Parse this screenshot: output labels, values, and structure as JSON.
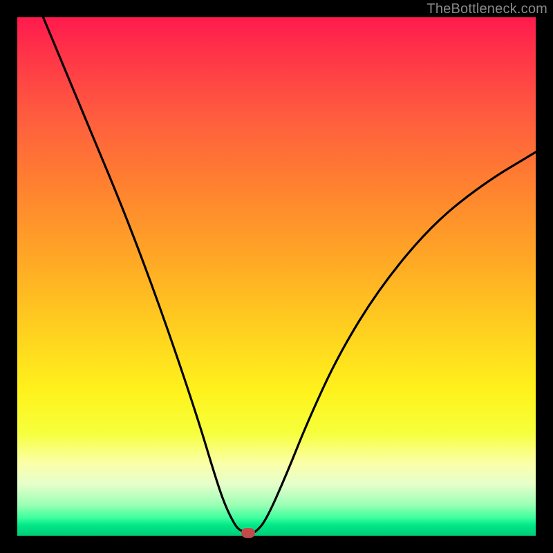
{
  "watermark": "TheBottleneck.com",
  "chart_data": {
    "type": "line",
    "title": "",
    "xlabel": "",
    "ylabel": "",
    "xlim": [
      0,
      100
    ],
    "ylim": [
      0,
      100
    ],
    "series": [
      {
        "name": "curve",
        "x": [
          5,
          10,
          15,
          20,
          25,
          30,
          35,
          38,
          40,
          42,
          43,
          44.5,
          45,
          46,
          48,
          52,
          56,
          62,
          70,
          80,
          90,
          100
        ],
        "y": [
          100,
          88,
          76,
          64,
          51,
          37,
          22,
          12,
          6,
          2,
          1,
          0.5,
          0.5,
          0.7,
          3,
          12,
          22,
          35,
          48,
          60,
          68,
          74
        ]
      }
    ],
    "marker": {
      "x": 44.5,
      "y": 0.5,
      "color": "#c24a4a"
    },
    "gradient_stops": [
      {
        "pos": 0,
        "color": "#ff1a4d"
      },
      {
        "pos": 0.72,
        "color": "#fff21c"
      },
      {
        "pos": 1.0,
        "color": "#00cc77"
      }
    ]
  }
}
